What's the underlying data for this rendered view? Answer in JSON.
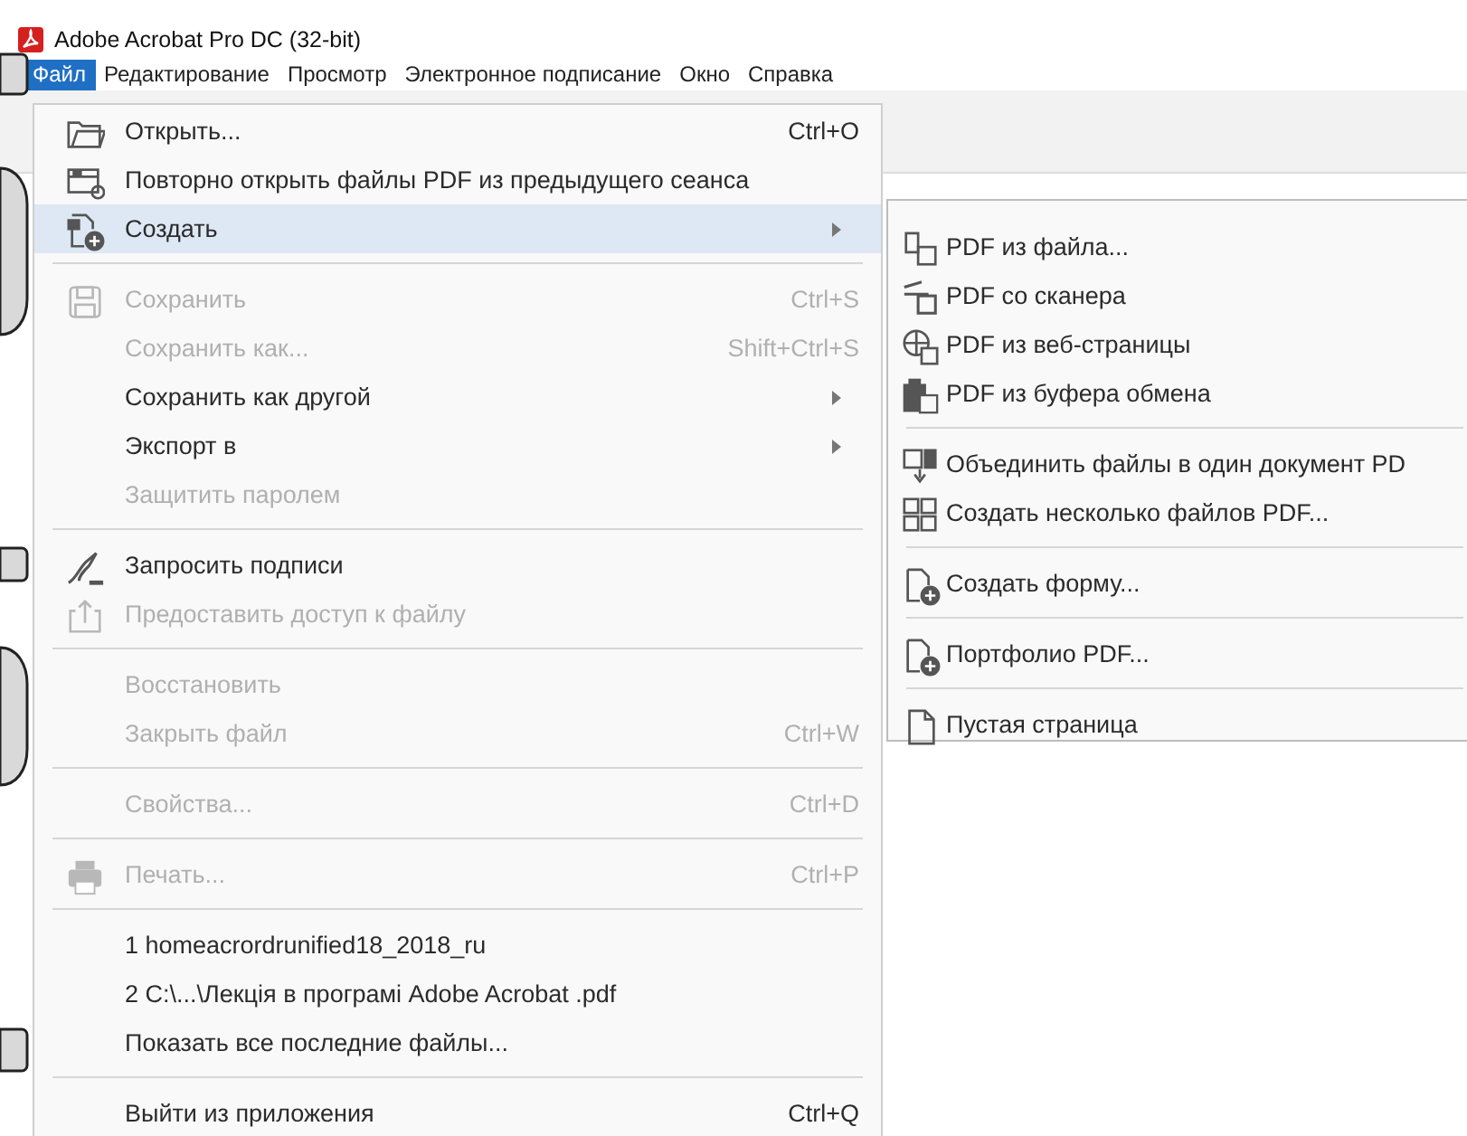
{
  "window": {
    "title": "Adobe Acrobat Pro DC (32-bit)"
  },
  "menubar": [
    {
      "label": "Файл",
      "selected": true
    },
    {
      "label": "Редактирование",
      "selected": false
    },
    {
      "label": "Просмотр",
      "selected": false
    },
    {
      "label": "Электронное подписание",
      "selected": false
    },
    {
      "label": "Окно",
      "selected": false
    },
    {
      "label": "Справка",
      "selected": false
    }
  ],
  "file_menu": [
    {
      "kind": "item",
      "label": "Открыть...",
      "shortcut": "Ctrl+O",
      "disabled": false,
      "selected": false,
      "submenu": false
    },
    {
      "kind": "item",
      "label": "Повторно открыть файлы PDF из предыдущего сеанса",
      "disabled": false,
      "selected": false,
      "submenu": false
    },
    {
      "kind": "item",
      "label": "Создать",
      "disabled": false,
      "selected": true,
      "submenu": true
    },
    {
      "kind": "separator"
    },
    {
      "kind": "item",
      "label": "Сохранить",
      "shortcut": "Ctrl+S",
      "disabled": true,
      "selected": false,
      "submenu": false
    },
    {
      "kind": "item",
      "label": "Сохранить как...",
      "shortcut": "Shift+Ctrl+S",
      "disabled": true,
      "selected": false,
      "submenu": false
    },
    {
      "kind": "item",
      "label": "Сохранить как другой",
      "disabled": false,
      "selected": false,
      "submenu": true
    },
    {
      "kind": "item",
      "label": "Экспорт в",
      "disabled": false,
      "selected": false,
      "submenu": true
    },
    {
      "kind": "item",
      "label": "Защитить паролем",
      "disabled": true,
      "selected": false,
      "submenu": false
    },
    {
      "kind": "separator"
    },
    {
      "kind": "item",
      "label": "Запросить подписи",
      "disabled": false,
      "selected": false,
      "submenu": false
    },
    {
      "kind": "item",
      "label": "Предоставить доступ к файлу",
      "disabled": true,
      "selected": false,
      "submenu": false
    },
    {
      "kind": "separator"
    },
    {
      "kind": "item",
      "label": "Восстановить",
      "disabled": true,
      "selected": false,
      "submenu": false
    },
    {
      "kind": "item",
      "label": "Закрыть файл",
      "shortcut": "Ctrl+W",
      "disabled": true,
      "selected": false,
      "submenu": false
    },
    {
      "kind": "separator"
    },
    {
      "kind": "item",
      "label": "Свойства...",
      "shortcut": "Ctrl+D",
      "disabled": true,
      "selected": false,
      "submenu": false
    },
    {
      "kind": "separator"
    },
    {
      "kind": "item",
      "label": "Печать...",
      "shortcut": "Ctrl+P",
      "disabled": true,
      "selected": false,
      "submenu": false
    },
    {
      "kind": "separator"
    },
    {
      "kind": "item",
      "label": "1 homeacrordrunified18_2018_ru",
      "disabled": false,
      "selected": false,
      "submenu": false
    },
    {
      "kind": "item",
      "label": "2 C:\\...\\Лекція  в програмі Adobe Acrobat .pdf",
      "disabled": false,
      "selected": false,
      "submenu": false
    },
    {
      "kind": "item",
      "label": "Показать все последние файлы...",
      "disabled": false,
      "selected": false,
      "submenu": false
    },
    {
      "kind": "separator"
    },
    {
      "kind": "item",
      "label": "Выйти из приложения",
      "shortcut": "Ctrl+Q",
      "disabled": false,
      "selected": false,
      "submenu": false
    }
  ],
  "create_submenu": [
    {
      "kind": "item",
      "label": "PDF из файла..."
    },
    {
      "kind": "item",
      "label": "PDF со сканера"
    },
    {
      "kind": "item",
      "label": "PDF из веб-страницы"
    },
    {
      "kind": "item",
      "label": "PDF из буфера обмена"
    },
    {
      "kind": "separator"
    },
    {
      "kind": "item",
      "label": "Объединить файлы в один документ PD"
    },
    {
      "kind": "item",
      "label": "Создать несколько файлов PDF..."
    },
    {
      "kind": "separator"
    },
    {
      "kind": "item",
      "label": "Создать форму..."
    },
    {
      "kind": "separator"
    },
    {
      "kind": "item",
      "label": "Портфолио PDF..."
    },
    {
      "kind": "separator"
    },
    {
      "kind": "item",
      "label": "Пустая страница"
    }
  ]
}
